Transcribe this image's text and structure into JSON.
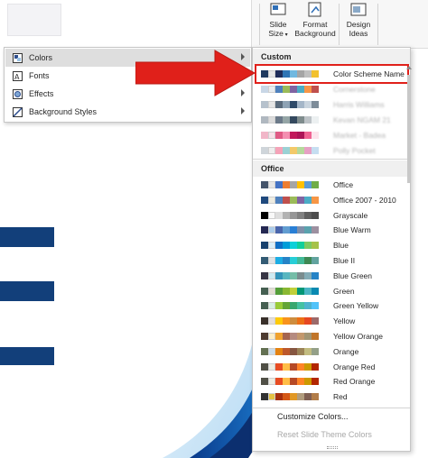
{
  "ribbon": {
    "slide_size_line1": "Slide",
    "slide_size_line2": "Size",
    "format_bg_line1": "Format",
    "format_bg_line2": "Background",
    "design_ideas_line1": "Design",
    "design_ideas_line2": "Ideas"
  },
  "menu": {
    "items": [
      {
        "label": "Colors",
        "icon": "colors-icon",
        "selected": true
      },
      {
        "label": "Fonts",
        "icon": "fonts-icon",
        "selected": false
      },
      {
        "label": "Effects",
        "icon": "effects-icon",
        "selected": false
      },
      {
        "label": "Background Styles",
        "icon": "background-styles-icon",
        "selected": false
      }
    ]
  },
  "flyout": {
    "custom_header": "Custom",
    "office_header": "Office",
    "custom_schemes": [
      {
        "name": "Color Scheme Name",
        "colors": [
          "#1f3a5f",
          "#e8e8e8",
          "#1f2d5a",
          "#2f75b5",
          "#70b8e0",
          "#a5a5a5",
          "#bfbfbf",
          "#f2c12e"
        ],
        "highlighted": true
      },
      {
        "name": "Cornerstone",
        "colors": [
          "#c9d7e6",
          "#e8ecf0",
          "#4f81bd",
          "#9bbb59",
          "#8064a2",
          "#4bacc6",
          "#f79646",
          "#c0504d"
        ],
        "blurred": true
      },
      {
        "name": "Harris Williams",
        "colors": [
          "#b6c1cc",
          "#e6e6e6",
          "#5a6b7c",
          "#8ea3b5",
          "#2f4b6a",
          "#a4b6c8",
          "#c9d4de",
          "#7d8c99"
        ],
        "blurred": true
      },
      {
        "name": "Kevan NGAM 21",
        "colors": [
          "#b0b8c0",
          "#dcdcdc",
          "#6c7a89",
          "#95a5a6",
          "#34495e",
          "#7f8c8d",
          "#bdc3c7",
          "#ecf0f1"
        ],
        "blurred": true
      },
      {
        "name": "Market - Badea",
        "colors": [
          "#f1b6c8",
          "#f8e1e9",
          "#e05a85",
          "#f48fb1",
          "#c2185b",
          "#ad1457",
          "#f06292",
          "#fce4ec"
        ],
        "blurred": true
      },
      {
        "name": "Polly Pocket",
        "colors": [
          "#cfd5da",
          "#eeeeee",
          "#f5a3b8",
          "#9ad1d4",
          "#f3c969",
          "#b5d99c",
          "#e6a0c4",
          "#c6def1"
        ],
        "blurred": true
      }
    ],
    "office_schemes": [
      {
        "name": "Office",
        "colors": [
          "#44546a",
          "#e7e6e6",
          "#4472c4",
          "#ed7d31",
          "#a5a5a5",
          "#ffc000",
          "#5b9bd5",
          "#70ad47"
        ]
      },
      {
        "name": "Office 2007 - 2010",
        "colors": [
          "#1f497d",
          "#eeece1",
          "#4f81bd",
          "#c0504d",
          "#9bbb59",
          "#8064a2",
          "#4bacc6",
          "#f79646"
        ]
      },
      {
        "name": "Grayscale",
        "colors": [
          "#000000",
          "#f8f8f8",
          "#dddddd",
          "#b2b2b2",
          "#969696",
          "#808080",
          "#5f5f5f",
          "#4d4d4d"
        ]
      },
      {
        "name": "Blue Warm",
        "colors": [
          "#242852",
          "#acccea",
          "#4a66ac",
          "#629dd1",
          "#297fd5",
          "#7f8fa9",
          "#5aa2ae",
          "#9d90a0"
        ]
      },
      {
        "name": "Blue",
        "colors": [
          "#17406d",
          "#dbeff9",
          "#0f6fc6",
          "#009dd9",
          "#0bd0d9",
          "#10cf9b",
          "#7cca62",
          "#a5c249"
        ]
      },
      {
        "name": "Blue II",
        "colors": [
          "#335b74",
          "#dfe3e5",
          "#1cade4",
          "#2683c6",
          "#27ced7",
          "#42ba97",
          "#3e8853",
          "#62a39f"
        ]
      },
      {
        "name": "Blue Green",
        "colors": [
          "#373545",
          "#ceebf2",
          "#3494ba",
          "#58b6c0",
          "#75bda7",
          "#7a8c8e",
          "#84acb6",
          "#2683c6"
        ]
      },
      {
        "name": "Green",
        "colors": [
          "#455f51",
          "#e3ded1",
          "#549e39",
          "#8ab833",
          "#c0cf3a",
          "#029676",
          "#4ab5c4",
          "#0989b1"
        ]
      },
      {
        "name": "Green Yellow",
        "colors": [
          "#455f51",
          "#d8f0e3",
          "#99cb38",
          "#63a537",
          "#37a76f",
          "#44c1a3",
          "#4eb3cf",
          "#51c3f9"
        ]
      },
      {
        "name": "Yellow",
        "colors": [
          "#39302a",
          "#e5dedb",
          "#ffca08",
          "#f8931d",
          "#ce8d3e",
          "#ec7016",
          "#e64823",
          "#9c6a6a"
        ]
      },
      {
        "name": "Yellow Orange",
        "colors": [
          "#4e3b30",
          "#fbeec9",
          "#f0a22e",
          "#a5644e",
          "#b58b80",
          "#c3986d",
          "#a19574",
          "#c17529"
        ]
      },
      {
        "name": "Orange",
        "colors": [
          "#637052",
          "#ccddea",
          "#e48312",
          "#bd582c",
          "#865640",
          "#9b8357",
          "#c2bc80",
          "#94a088"
        ]
      },
      {
        "name": "Orange Red",
        "colors": [
          "#505046",
          "#eeece1",
          "#e84c22",
          "#ffbd47",
          "#b64926",
          "#ff8427",
          "#cc9900",
          "#b22600"
        ]
      },
      {
        "name": "Red Orange",
        "colors": [
          "#505046",
          "#eeece1",
          "#e84c22",
          "#ffbd47",
          "#b64926",
          "#ff8427",
          "#cc9900",
          "#b22600"
        ]
      },
      {
        "name": "Red",
        "colors": [
          "#323232",
          "#e5c243",
          "#a5300f",
          "#d55816",
          "#e19825",
          "#b19c7d",
          "#7f5f52",
          "#b27d49"
        ]
      }
    ],
    "customize_label": "Customize Colors...",
    "reset_label": "Reset Slide Theme Colors"
  },
  "colors": {
    "accent_red": "#e0201a",
    "slide_bar_blue": "#123f7a",
    "menu_selected_bg": "#dedede"
  }
}
